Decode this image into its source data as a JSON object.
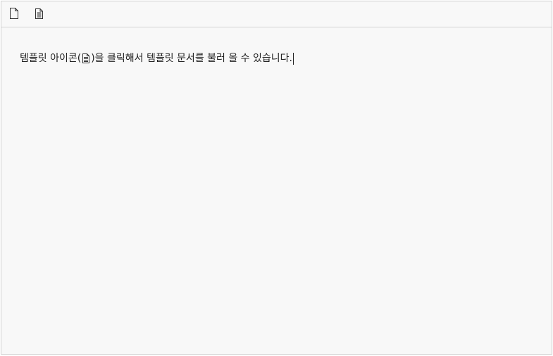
{
  "toolbar": {
    "buttons": [
      {
        "icon": "new-document-icon"
      },
      {
        "icon": "template-icon"
      }
    ]
  },
  "content": {
    "text_before_icon": "템플릿 아이콘(",
    "inline_icon": "template-icon",
    "text_after_icon": ")을 클릭해서 템플릿 문서를 불러 올 수 있습니다."
  },
  "colors": {
    "background": "#f8f8f8",
    "border": "#cfcfcf",
    "text": "#222222"
  }
}
